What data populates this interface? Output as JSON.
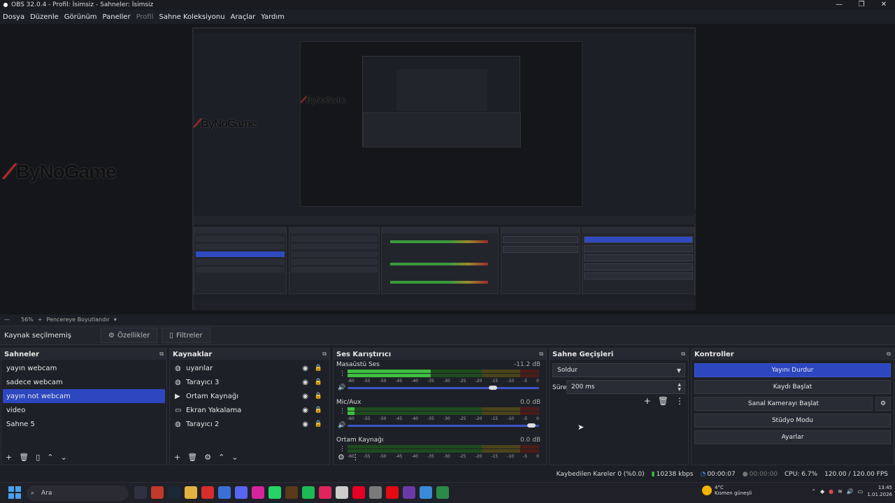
{
  "window": {
    "title": "OBS 32.0.4 - Profil: İsimsiz - Sahneler: İsimsiz",
    "controls": [
      "—",
      "❐",
      "✕"
    ]
  },
  "menu": [
    "Dosya",
    "Düzenle",
    "Görünüm",
    "Paneller",
    "Profil",
    "Sahne Koleksiyonu",
    "Araçlar",
    "Yardım"
  ],
  "preview": {
    "watermark": "ByNoGame",
    "zoom": "56%",
    "fit_label": "Pencereye Boyutlandır"
  },
  "source_bar": {
    "label": "Kaynak seçilmemiş",
    "properties": "Özellikler",
    "filters": "Filtreler"
  },
  "scenes": {
    "title": "Sahneler",
    "items": [
      "yayın webcam",
      "sadece webcam",
      "yayın not webcam",
      "video",
      "Sahne 5"
    ],
    "selected_index": 2
  },
  "sources": {
    "title": "Kaynaklar",
    "items": [
      {
        "label": "uyarılar",
        "icon": "globe-icon"
      },
      {
        "label": "Tarayıcı 3",
        "icon": "globe-icon"
      },
      {
        "label": "Ortam Kaynağı",
        "icon": "play-icon"
      },
      {
        "label": "Ekran Yakalama",
        "icon": "monitor-icon"
      },
      {
        "label": "Tarayıcı 2",
        "icon": "globe-icon"
      }
    ]
  },
  "mixer": {
    "title": "Ses Karıştırıcı",
    "ticks": [
      "-60",
      "-55",
      "-50",
      "-45",
      "-40",
      "-35",
      "-30",
      "-25",
      "-20",
      "-15",
      "-10",
      "-5",
      "0"
    ],
    "channels": [
      {
        "name": "Masaüstü Ses",
        "db": "-11.2 dB",
        "level": 0.62,
        "volume": 0.78
      },
      {
        "name": "Mic/Aux",
        "db": "0.0 dB",
        "level": 0.05,
        "volume": 0.98
      },
      {
        "name": "Ortam Kaynağı",
        "db": "0.0 dB",
        "level": 0.0,
        "volume": 1.0
      }
    ]
  },
  "transitions": {
    "title": "Sahne Geçişleri",
    "type": "Soldur",
    "duration_label": "Süre",
    "duration_value": "200 ms"
  },
  "controls": {
    "title": "Kontroller",
    "stop_stream": "Yayını Durdur",
    "start_record": "Kaydı Başlat",
    "virtual_cam": "Sanal Kamerayı Başlat",
    "studio_mode": "Stüdyo Modu",
    "settings": "Ayarlar"
  },
  "status": {
    "dropped": "Kaybedilen Kareler 0 (%0.0)",
    "bitrate": "10238 kbps",
    "stream_time": "00:00:07",
    "record_time": "00:00:00",
    "cpu": "CPU: 6.7%",
    "fps": "120.00 / 120.00 FPS"
  },
  "taskbar": {
    "search": "Ara",
    "weather_temp": "4°C",
    "weather_desc": "Kısmen güneşli",
    "time": "13:45",
    "date": "1.01.2026",
    "app_colors": [
      "#2f3140",
      "#c0392b",
      "#1b2838",
      "#e3b341",
      "#d62d2d",
      "#3a6fd8",
      "#5865f2",
      "#d6249f",
      "#25d366",
      "#5a3a1a",
      "#1db954",
      "#e0245e",
      "#cccccc",
      "#e60023",
      "#7a7a7a",
      "#e50914",
      "#6a3aa8",
      "#3a8ad8",
      "#2a8a4a"
    ]
  },
  "colors": {
    "accent": "#2c47c0",
    "meter_green": "#3fbf3f",
    "meter_yellow": "#c9b22c",
    "meter_red": "#c0302c"
  }
}
